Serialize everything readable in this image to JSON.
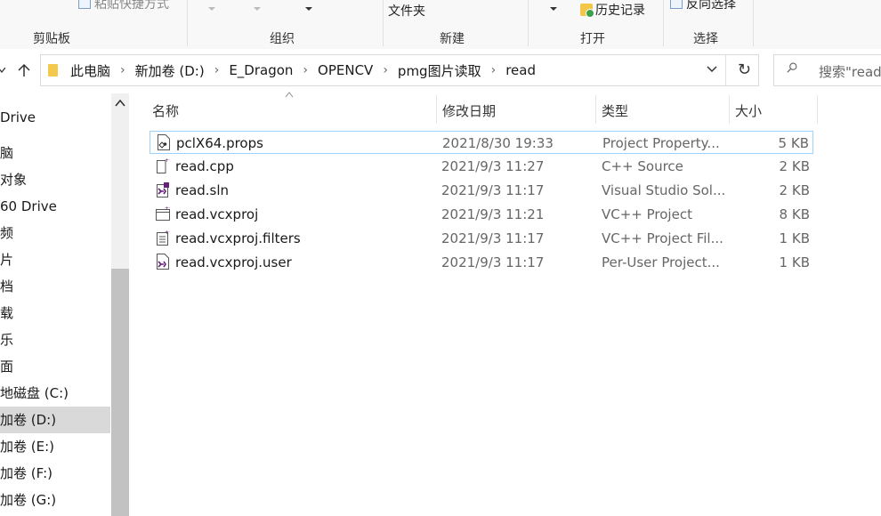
{
  "ribbon": {
    "paste_shortcut": "粘贴快捷方式",
    "new_item": "文件夹",
    "history": "历史记录",
    "invert_selection": "反向选择",
    "groups": [
      "剪贴板",
      "组织",
      "新建",
      "打开",
      "选择"
    ]
  },
  "address": {
    "crumbs": [
      "此电脑",
      "新加卷 (D:)",
      "E_Dragon",
      "OPENCV",
      "pmg图片读取",
      "read"
    ],
    "search_placeholder": "搜索\"read"
  },
  "sidebar": {
    "items": [
      "Drive",
      "脑",
      "对象",
      "60 Drive",
      "频",
      "片",
      "档",
      "载",
      "乐",
      "面",
      "地磁盘 (C:)",
      "加卷 (D:)",
      "加卷 (E:)",
      "加卷 (F:)",
      "加卷 (G:)"
    ],
    "selected_index": 11
  },
  "columns": {
    "name": "名称",
    "modified": "修改日期",
    "type": "类型",
    "size": "大小"
  },
  "files": [
    {
      "name": "pclX64.props",
      "modified": "2021/8/30 19:33",
      "type": "Project Property...",
      "size": "5 KB",
      "icon": "props-file-icon"
    },
    {
      "name": "read.cpp",
      "modified": "2021/9/3 11:27",
      "type": "C++ Source",
      "size": "2 KB",
      "icon": "cpp-file-icon"
    },
    {
      "name": "read.sln",
      "modified": "2021/9/3 11:17",
      "type": "Visual Studio Sol...",
      "size": "2 KB",
      "icon": "sln-file-icon"
    },
    {
      "name": "read.vcxproj",
      "modified": "2021/9/3 11:21",
      "type": "VC++ Project",
      "size": "8 KB",
      "icon": "vcxproj-file-icon"
    },
    {
      "name": "read.vcxproj.filters",
      "modified": "2021/9/3 11:17",
      "type": "VC++ Project Fil...",
      "size": "1 KB",
      "icon": "filters-file-icon"
    },
    {
      "name": "read.vcxproj.user",
      "modified": "2021/9/3 11:17",
      "type": "Per-User Project...",
      "size": "1 KB",
      "icon": "user-file-icon"
    }
  ],
  "colors": {
    "selected_bg": "#d9d9d9",
    "focus_border": "#99d1ff",
    "vs_purple": "#68217a"
  }
}
